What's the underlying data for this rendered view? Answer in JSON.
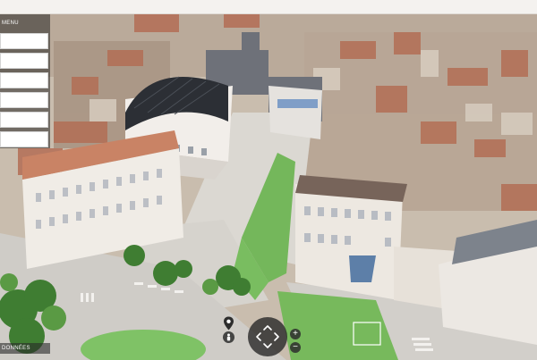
{
  "menu": {
    "title": "MENU",
    "items": [
      "",
      "",
      "",
      "",
      "",
      ""
    ]
  },
  "footer_label": "DONNÉES",
  "controls": {
    "zoom_in": "+",
    "zoom_out": "−",
    "icons": [
      "location-pin-icon",
      "person-icon",
      "compass-icon"
    ]
  },
  "colors": {
    "accent_dark": "#2d2d2d",
    "panel": "#ffffff",
    "grass": "#74b75b"
  }
}
